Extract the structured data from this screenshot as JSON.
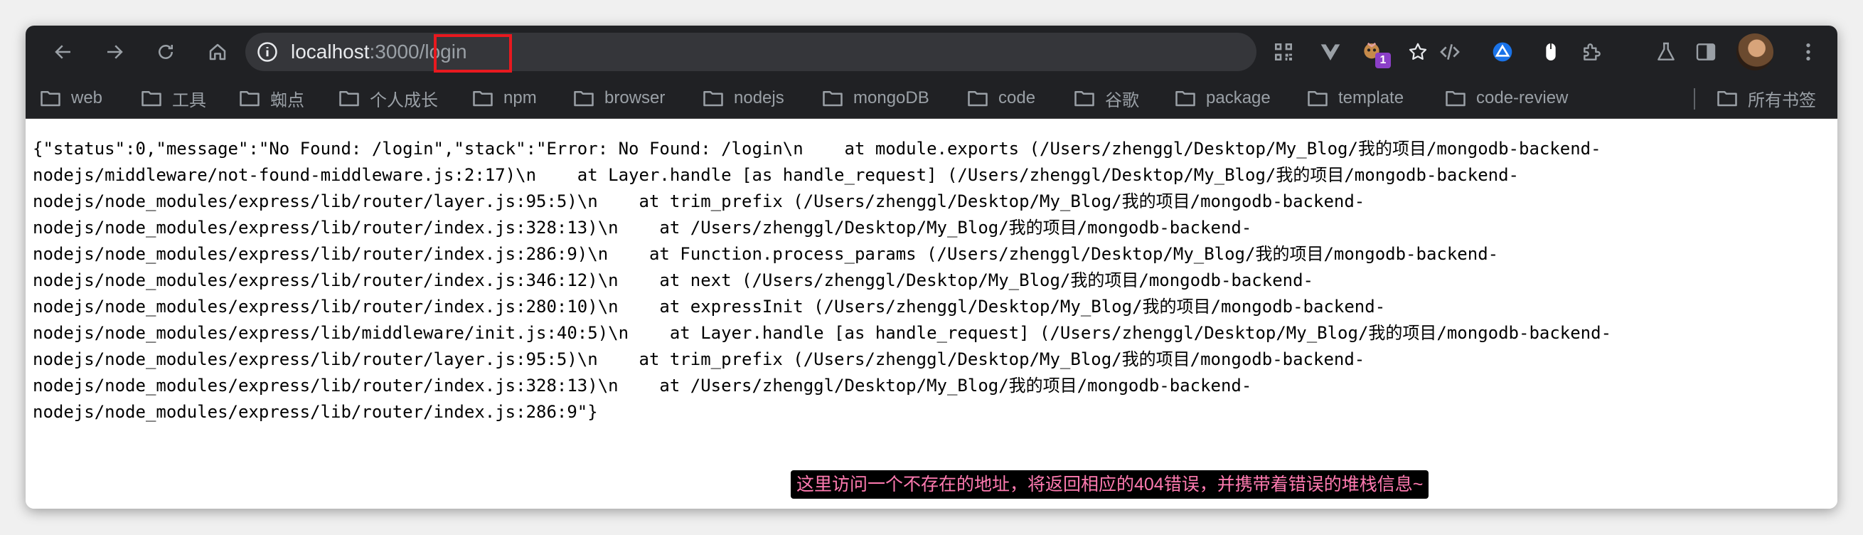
{
  "browser": {
    "url_host": "localhost",
    "url_port": ":3000",
    "url_path": "/login",
    "accent_color": "#e8191f",
    "extension_badge": "1"
  },
  "bookmarks": [
    {
      "label": "web"
    },
    {
      "label": "工具"
    },
    {
      "label": "蜘点"
    },
    {
      "label": "个人成长"
    },
    {
      "label": "npm"
    },
    {
      "label": "browser"
    },
    {
      "label": "nodejs"
    },
    {
      "label": "mongoDB"
    },
    {
      "label": "code"
    },
    {
      "label": "谷歌"
    },
    {
      "label": "package"
    },
    {
      "label": "template"
    },
    {
      "label": "code-review"
    }
  ],
  "all_bookmarks_label": "所有书签",
  "page": {
    "lines": [
      "{\"status\":0,\"message\":\"No Found: /login\",\"stack\":\"Error: No Found: /login\\n    at module.exports (/Users/zhenggl/Desktop/My_Blog/我的项目/mongodb-backend-",
      "nodejs/middleware/not-found-middleware.js:2:17)\\n    at Layer.handle [as handle_request] (/Users/zhenggl/Desktop/My_Blog/我的项目/mongodb-backend-",
      "nodejs/node_modules/express/lib/router/layer.js:95:5)\\n    at trim_prefix (/Users/zhenggl/Desktop/My_Blog/我的项目/mongodb-backend-",
      "nodejs/node_modules/express/lib/router/index.js:328:13)\\n    at /Users/zhenggl/Desktop/My_Blog/我的项目/mongodb-backend-",
      "nodejs/node_modules/express/lib/router/index.js:286:9)\\n    at Function.process_params (/Users/zhenggl/Desktop/My_Blog/我的项目/mongodb-backend-",
      "nodejs/node_modules/express/lib/router/index.js:346:12)\\n    at next (/Users/zhenggl/Desktop/My_Blog/我的项目/mongodb-backend-",
      "nodejs/node_modules/express/lib/router/index.js:280:10)\\n    at expressInit (/Users/zhenggl/Desktop/My_Blog/我的项目/mongodb-backend-",
      "nodejs/node_modules/express/lib/middleware/init.js:40:5)\\n    at Layer.handle [as handle_request] (/Users/zhenggl/Desktop/My_Blog/我的项目/mongodb-backend-",
      "nodejs/node_modules/express/lib/router/layer.js:95:5)\\n    at trim_prefix (/Users/zhenggl/Desktop/My_Blog/我的项目/mongodb-backend-",
      "nodejs/node_modules/express/lib/router/index.js:328:13)\\n    at /Users/zhenggl/Desktop/My_Blog/我的项目/mongodb-backend-",
      "nodejs/node_modules/express/lib/router/index.js:286:9\"}"
    ],
    "caption": "这里访问一个不存在的地址，将返回相应的404错误，并携带着错误的堆栈信息~"
  }
}
